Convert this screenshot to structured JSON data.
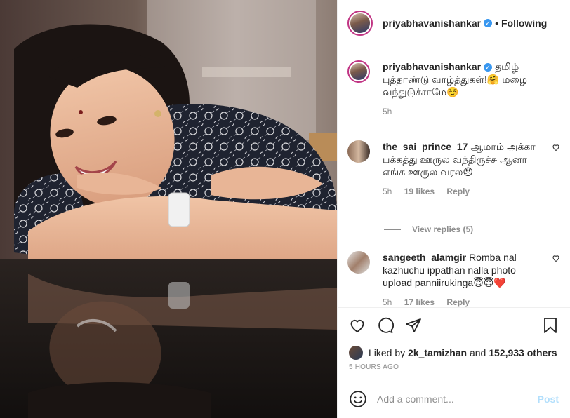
{
  "post": {
    "username": "priyabhavanishankar",
    "verified_glyph": "✓",
    "separator": "•",
    "follow_status": "Following"
  },
  "caption": {
    "username": "priyabhavanishankar",
    "text": "தமிழ் புத்தாண்டு வாழ்த்துகள்!🤗 மழை வந்துடுச்சாமே☺️",
    "time": "5h"
  },
  "comments": [
    {
      "username": "the_sai_prince_17",
      "text": "ஆமாம் அக்கா பக்கத்து ஊருல வந்திருச்சு ஆனா எங்க ஊருல வரல😞",
      "time": "5h",
      "likes": "19 likes",
      "reply": "Reply"
    },
    {
      "username": "sangeeth_alamgir",
      "text": "Romba nal kazhuchu ippathan nalla photo upload panniirukinga😇😇❤️",
      "time": "5h",
      "likes": "17 likes",
      "reply": "Reply"
    }
  ],
  "view_replies": "View replies (5)",
  "likes_line": {
    "prefix": "Liked by",
    "user": "2k_tamizhan",
    "conj": "and",
    "count": "152,933 others"
  },
  "timestamp": "5 HOURS AGO",
  "add_comment": {
    "placeholder": "Add a comment...",
    "post_label": "Post"
  },
  "icons": {
    "like": "heart-icon",
    "comment": "comment-bubble-icon",
    "share": "paper-plane-icon",
    "save": "bookmark-icon",
    "emoji": "smiley-icon"
  },
  "colors": {
    "verified": "#3897f0",
    "post_disabled": "#b2dffc",
    "muted": "#8e8e8e",
    "heart_red": "#ed4956"
  }
}
